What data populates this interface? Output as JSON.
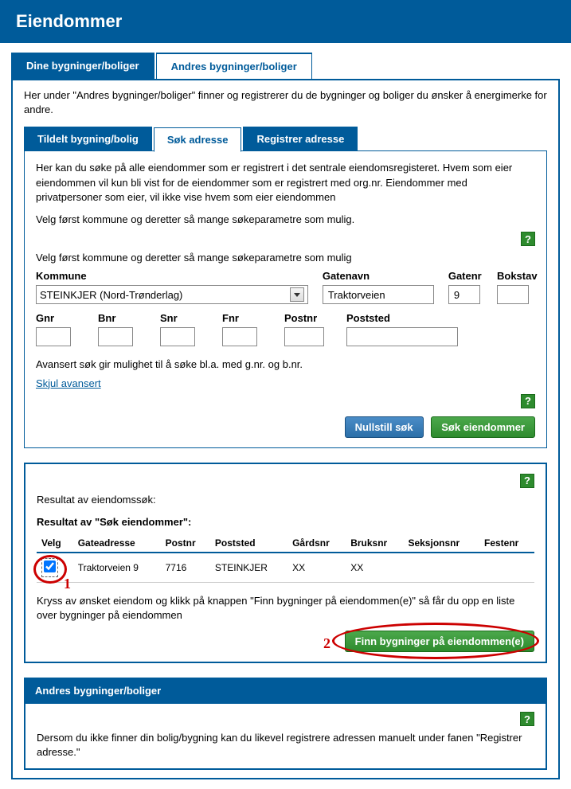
{
  "header": {
    "title": "Eiendommer"
  },
  "tabs": {
    "items": [
      {
        "label": "Dine bygninger/boliger"
      },
      {
        "label": "Andres bygninger/boliger"
      }
    ],
    "intro": "Her under \"Andres bygninger/boliger\" finner og registrerer du de bygninger og boliger du ønsker å energimerke for andre."
  },
  "subtabs": {
    "items": [
      {
        "label": "Tildelt bygning/bolig"
      },
      {
        "label": "Søk adresse"
      },
      {
        "label": "Registrer adresse"
      }
    ]
  },
  "search": {
    "desc1": "Her kan du søke på alle eiendommer som er registrert i det sentrale eiendomsregisteret. Hvem som eier eiendommen vil kun bli vist for de eiendommer som er registrert med org.nr. Eiendommer med privatpersoner som eier, vil ikke vise hvem som eier eiendommen",
    "desc2": "Velg først kommune og deretter så mange søkeparametre som mulig.",
    "desc3": "Velg først kommune og deretter så mange søkeparametre som mulig",
    "labels": {
      "kommune": "Kommune",
      "gatenavn": "Gatenavn",
      "gatenr": "Gatenr",
      "bokstav": "Bokstav",
      "gnr": "Gnr",
      "bnr": "Bnr",
      "snr": "Snr",
      "fnr": "Fnr",
      "postnr": "Postnr",
      "poststed": "Poststed"
    },
    "values": {
      "kommune": "STEINKJER (Nord-Trønderlag)",
      "gatenavn": "Traktorveien",
      "gatenr": "9"
    },
    "adv_text": "Avansert søk gir mulighet til å søke bl.a. med g.nr. og b.nr.",
    "adv_link": "Skjul avansert",
    "btn_reset": "Nullstill søk",
    "btn_search": "Søk eiendommer",
    "help": "?"
  },
  "results": {
    "help": "?",
    "title": "Resultat av eiendomssøk:",
    "subtitle": "Resultat av \"Søk eiendommer\":",
    "headers": {
      "velg": "Velg",
      "gateadresse": "Gateadresse",
      "postnr": "Postnr",
      "poststed": "Poststed",
      "gardsnr": "Gårdsnr",
      "bruksnr": "Bruksnr",
      "seksjonsnr": "Seksjonsnr",
      "festenr": "Festenr"
    },
    "rows": [
      {
        "gateadresse": "Traktorveien 9",
        "postnr": "7716",
        "poststed": "STEINKJER",
        "gardsnr": "XX",
        "bruksnr": "XX",
        "seksjonsnr": "",
        "festenr": ""
      }
    ],
    "instruction": "Kryss av ønsket eiendom og klikk på knappen \"Finn bygninger på eiendommen(e)\" så får du opp en liste over bygninger på eiendommen",
    "btn_find": "Finn bygninger på eiendommen(e)",
    "annotations": {
      "one": "1",
      "two": "2"
    }
  },
  "bottom": {
    "bar": "Andres bygninger/boliger",
    "help": "?",
    "text": "Dersom du ikke finner din bolig/bygning kan du likevel registrere adressen manuelt under fanen \"Registrer adresse.\""
  }
}
